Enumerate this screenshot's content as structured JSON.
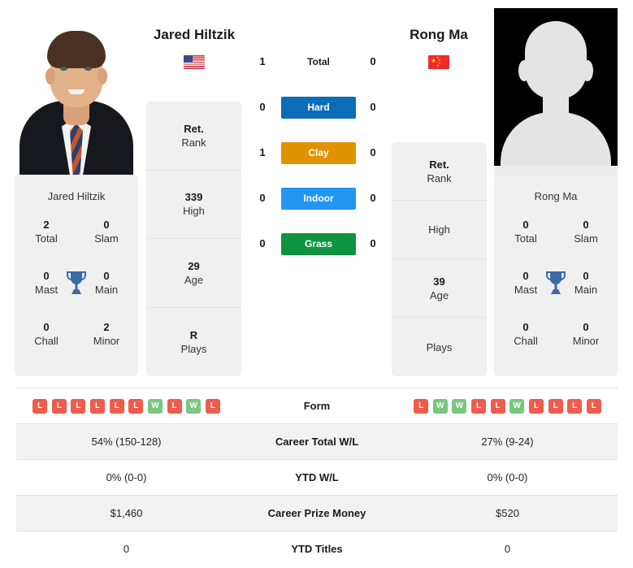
{
  "players": {
    "left": {
      "name": "Jared Hiltzik",
      "flag": "us-flag-icon",
      "photo": "player-headshot",
      "titles": {
        "card_name": "Jared Hiltzik",
        "total": "2",
        "total_label": "Total",
        "slam": "0",
        "slam_label": "Slam",
        "mast": "0",
        "mast_label": "Mast",
        "main": "0",
        "main_label": "Main",
        "chall": "0",
        "chall_label": "Chall",
        "minor": "2",
        "minor_label": "Minor",
        "trophy_icon": "trophy-icon"
      },
      "stack": [
        {
          "value": "Ret.",
          "label": "Rank"
        },
        {
          "value": "339",
          "label": "High"
        },
        {
          "value": "29",
          "label": "Age"
        },
        {
          "value": "R",
          "label": "Plays"
        }
      ]
    },
    "right": {
      "name": "Rong Ma",
      "flag": "cn-flag-icon",
      "photo": "player-silhouette-placeholder",
      "titles": {
        "card_name": "Rong Ma",
        "total": "0",
        "total_label": "Total",
        "slam": "0",
        "slam_label": "Slam",
        "mast": "0",
        "mast_label": "Mast",
        "main": "0",
        "main_label": "Main",
        "chall": "0",
        "chall_label": "Chall",
        "minor": "0",
        "minor_label": "Minor",
        "trophy_icon": "trophy-icon"
      },
      "stack": [
        {
          "value": "Ret.",
          "label": "Rank"
        },
        {
          "value": "",
          "label": "High"
        },
        {
          "value": "39",
          "label": "Age"
        },
        {
          "value": "",
          "label": "Plays"
        }
      ]
    }
  },
  "surface_bars": [
    {
      "left": "1",
      "label": "Total",
      "right": "0",
      "color": ""
    },
    {
      "left": "0",
      "label": "Hard",
      "right": "0",
      "color": "#0b6cb8"
    },
    {
      "left": "1",
      "label": "Clay",
      "right": "0",
      "color": "#e09200"
    },
    {
      "left": "0",
      "label": "Indoor",
      "right": "0",
      "color": "#2196f3"
    },
    {
      "left": "0",
      "label": "Grass",
      "right": "0",
      "color": "#0e9440"
    }
  ],
  "comparison_rows": [
    {
      "label": "Form",
      "type": "form",
      "left_form": [
        "L",
        "L",
        "L",
        "L",
        "L",
        "L",
        "W",
        "L",
        "W",
        "L"
      ],
      "right_form": [
        "L",
        "W",
        "W",
        "L",
        "L",
        "W",
        "L",
        "L",
        "L",
        "L"
      ],
      "left": "",
      "right": ""
    },
    {
      "label": "Career Total W/L",
      "type": "text",
      "left": "54% (150-128)",
      "right": "27% (9-24)"
    },
    {
      "label": "YTD W/L",
      "type": "text",
      "left": "0% (0-0)",
      "right": "0% (0-0)"
    },
    {
      "label": "Career Prize Money",
      "type": "text",
      "left": "$1,460",
      "right": "$520"
    },
    {
      "label": "YTD Titles",
      "type": "text",
      "left": "0",
      "right": "0"
    }
  ],
  "colors": {
    "win_badge": "#7ac77f",
    "loss_badge": "#ef5b4c",
    "card_bg": "#f0f0f0",
    "row_alt_bg": "#f2f2f2",
    "trophy": "#3a6ba5"
  }
}
